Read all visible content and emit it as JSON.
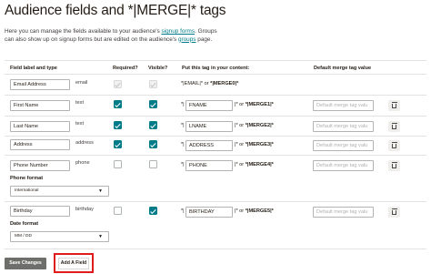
{
  "page": {
    "title": "Audience fields and *|MERGE|* tags",
    "description_prefix": "Here you can manage the fields available to your audience's ",
    "signup_forms_link": "signup forms",
    "description_mid": ". Groups can also show up on signup forms but are edited on the audience's ",
    "groups_link": "groups",
    "description_suffix": " page."
  },
  "table": {
    "headers": {
      "field_label": "Field label and type",
      "required": "Required?",
      "visible": "Visible?",
      "tag": "Put this tag in your content:",
      "default_value": "Default merge tag value"
    },
    "email_row": {
      "label": "Email Address",
      "type": "email",
      "required": true,
      "visible": true,
      "tag_prefix": "*|EMAIL|* or ",
      "tag_alt": "*|MERGE0|*"
    },
    "rows": [
      {
        "label": "First Name",
        "type": "text",
        "required": true,
        "visible": true,
        "tag_name": "FNAME",
        "tag_alt": "*|MERGE1|*",
        "default_placeholder": "Default merge tag valu"
      },
      {
        "label": "Last Name",
        "type": "text",
        "required": true,
        "visible": true,
        "tag_name": "LNAME",
        "tag_alt": "*|MERGE2|*",
        "default_placeholder": "Default merge tag valu"
      },
      {
        "label": "Address",
        "type": "address",
        "required": true,
        "visible": true,
        "tag_name": "ADDRESS",
        "tag_alt": "*|MERGE3|*",
        "default_placeholder": "Default merge tag valu"
      },
      {
        "label": "Phone Number",
        "type": "phone",
        "required": false,
        "visible": false,
        "tag_name": "PHONE",
        "tag_alt": "*|MERGE4|*",
        "default_placeholder": "Default merge tag valu"
      },
      {
        "label": "Birthday",
        "type": "birthday",
        "required": false,
        "visible": true,
        "tag_name": "BIRTHDAY",
        "tag_alt": "*|MERGE5|*",
        "default_placeholder": "Default merge tag valu"
      }
    ],
    "tag_open": "*|",
    "tag_close": "|* or ",
    "phone_format": {
      "label": "Phone format",
      "value": "International"
    },
    "date_format": {
      "label": "Date format",
      "value": "MM / DD"
    }
  },
  "actions": {
    "save_label": "Save Changes",
    "add_label": "Add A Field"
  },
  "colors": {
    "accent": "#007c89",
    "highlight": "#e01b1b",
    "save_button": "#6e6e6a"
  }
}
